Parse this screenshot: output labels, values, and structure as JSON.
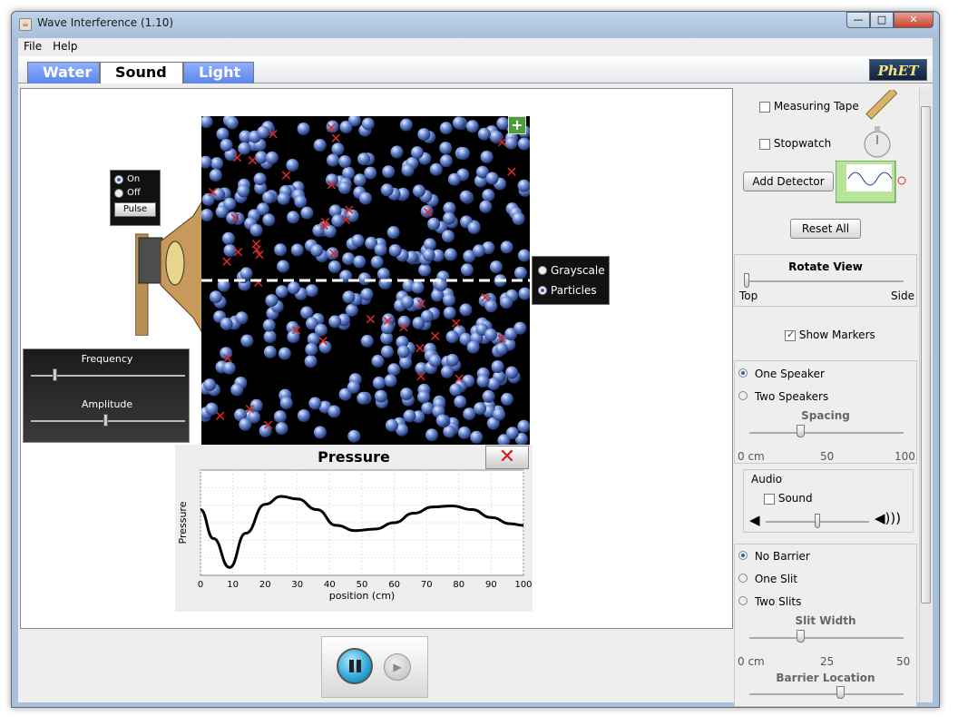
{
  "window": {
    "title": "Wave Interference (1.10)",
    "close": "✕",
    "minimize": "—",
    "maximize": "□"
  },
  "menu": [
    "File",
    "Help"
  ],
  "tabs": [
    "Water",
    "Sound",
    "Light"
  ],
  "logo": "PhET",
  "source": {
    "on": "On",
    "off": "Off",
    "pulse": "Pulse"
  },
  "sliders": {
    "frequency": "Frequency",
    "amplitude": "Amplitude"
  },
  "view_mode": {
    "grayscale": "Grayscale",
    "particles": "Particles"
  },
  "zoom": "+",
  "pressure": {
    "title": "Pressure",
    "close": "✕",
    "ylabel": "Pressure",
    "xlabel": "position (cm)",
    "xticks": [
      "0",
      "10",
      "20",
      "30",
      "40",
      "50",
      "60",
      "70",
      "80",
      "90",
      "100"
    ]
  },
  "chart_data": {
    "type": "line",
    "title": "Pressure",
    "xlabel": "position (cm)",
    "ylabel": "Pressure",
    "xlim": [
      0,
      100
    ],
    "ylim": [
      -1,
      1
    ],
    "x": [
      0,
      4,
      9,
      14,
      20,
      25,
      30,
      36,
      42,
      48,
      54,
      60,
      66,
      72,
      78,
      84,
      90,
      96,
      100
    ],
    "y": [
      0.25,
      -0.3,
      -0.85,
      -0.2,
      0.35,
      0.5,
      0.45,
      0.25,
      -0.05,
      -0.15,
      -0.12,
      0.0,
      0.18,
      0.3,
      0.32,
      0.25,
      0.1,
      -0.02,
      -0.05
    ]
  },
  "controls": {
    "measuring_tape": "Measuring Tape",
    "stopwatch": "Stopwatch",
    "add_detector": "Add Detector",
    "reset_all": "Reset All",
    "rotate_view": "Rotate View",
    "rotate_top": "Top",
    "rotate_side": "Side",
    "show_markers": "Show Markers",
    "one_speaker": "One Speaker",
    "two_speakers": "Two Speakers",
    "spacing": "Spacing",
    "spacing_ticks": [
      "0 cm",
      "50",
      "100"
    ],
    "audio": "Audio",
    "sound": "Sound",
    "no_barrier": "No Barrier",
    "one_slit": "One Slit",
    "two_slits": "Two Slits",
    "slit_width": "Slit Width",
    "slit_ticks": [
      "0 cm",
      "25",
      "50"
    ],
    "barrier_location": "Barrier Location"
  },
  "playback": {
    "pause": "pause",
    "step": "step"
  }
}
